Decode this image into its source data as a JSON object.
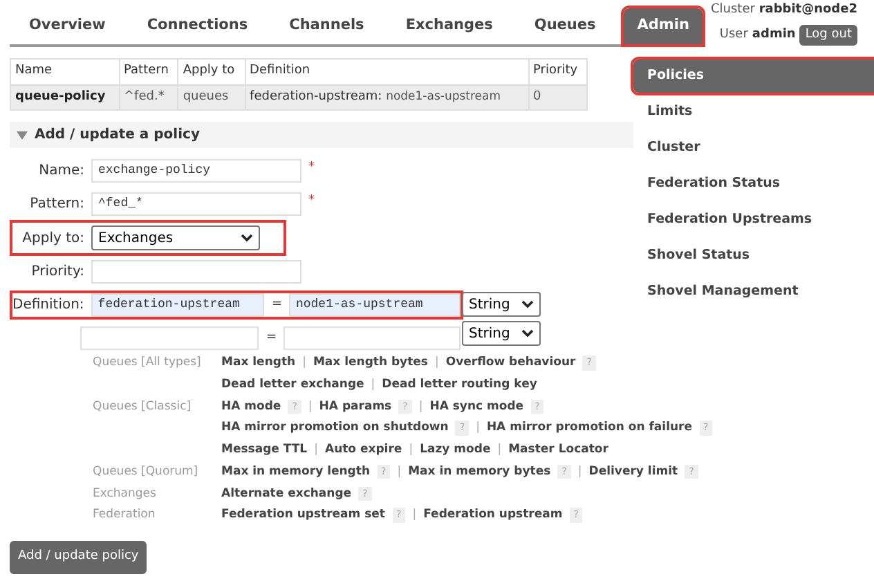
{
  "header": {
    "cluster_label": "Cluster",
    "cluster_name": "rabbit@node2",
    "user_label": "User",
    "user_name": "admin",
    "logout": "Log out"
  },
  "tabs": [
    {
      "label": "Overview",
      "selected": false,
      "highlighted": false
    },
    {
      "label": "Connections",
      "selected": false,
      "highlighted": false
    },
    {
      "label": "Channels",
      "selected": false,
      "highlighted": false
    },
    {
      "label": "Exchanges",
      "selected": false,
      "highlighted": false
    },
    {
      "label": "Queues",
      "selected": false,
      "highlighted": false
    },
    {
      "label": "Admin",
      "selected": true,
      "highlighted": true
    }
  ],
  "policies_table": {
    "columns": [
      "Name",
      "Pattern",
      "Apply to",
      "Definition",
      "Priority"
    ],
    "rows": [
      {
        "name": "queue-policy",
        "pattern": "^fed.*",
        "apply_to": "queues",
        "definition_key": "federation-upstream:",
        "definition_value": "node1-as-upstream",
        "priority": "0"
      }
    ]
  },
  "section": {
    "title": "Add / update a policy",
    "expanded": true
  },
  "form": {
    "name": {
      "label": "Name:",
      "value": "exchange-policy",
      "required": "*"
    },
    "pattern": {
      "label": "Pattern:",
      "value": "^fed_*",
      "required": "*"
    },
    "apply_to": {
      "label": "Apply to:",
      "value": "Exchanges",
      "highlighted": true
    },
    "priority": {
      "label": "Priority:"
    },
    "definition": {
      "label": "Definition:",
      "highlighted": true,
      "rows": [
        {
          "key": "federation-upstream",
          "equals": "=",
          "value": "node1-as-upstream",
          "type": "String"
        },
        {
          "key": "",
          "equals": "=",
          "value": "",
          "type": "String"
        }
      ]
    }
  },
  "help_groups": [
    {
      "label": "Queues [All types]",
      "lines": [
        [
          {
            "text": "Max length",
            "help": false
          },
          {
            "text": "Max length bytes",
            "help": false
          },
          {
            "text": "Overflow behaviour",
            "help": true
          }
        ],
        [
          {
            "text": "Dead letter exchange",
            "help": false
          },
          {
            "text": "Dead letter routing key",
            "help": false
          }
        ]
      ]
    },
    {
      "label": "Queues [Classic]",
      "lines": [
        [
          {
            "text": "HA mode",
            "help": true
          },
          {
            "text": "HA params",
            "help": true
          },
          {
            "text": "HA sync mode",
            "help": true
          }
        ],
        [
          {
            "text": "HA mirror promotion on shutdown",
            "help": true
          },
          {
            "text": "HA mirror promotion on failure",
            "help": true
          }
        ],
        [
          {
            "text": "Message TTL",
            "help": false
          },
          {
            "text": "Auto expire",
            "help": false
          },
          {
            "text": "Lazy mode",
            "help": false
          },
          {
            "text": "Master Locator",
            "help": false
          }
        ]
      ]
    },
    {
      "label": "Queues [Quorum]",
      "lines": [
        [
          {
            "text": "Max in memory length",
            "help": true
          },
          {
            "text": "Max in memory bytes",
            "help": true
          },
          {
            "text": "Delivery limit",
            "help": true
          }
        ]
      ]
    },
    {
      "label": "Exchanges",
      "lines": [
        [
          {
            "text": "Alternate exchange",
            "help": true
          }
        ]
      ]
    },
    {
      "label": "Federation",
      "lines": [
        [
          {
            "text": "Federation upstream set",
            "help": true
          },
          {
            "text": "Federation upstream",
            "help": true
          }
        ]
      ]
    }
  ],
  "help_mark": "?",
  "separator": "|",
  "submit": "Add / update policy",
  "sidebar": {
    "items": [
      {
        "label": "Policies",
        "selected": true,
        "highlighted": true
      },
      {
        "label": "Limits",
        "selected": false,
        "highlighted": false
      },
      {
        "label": "Cluster",
        "selected": false,
        "highlighted": false
      },
      {
        "label": "Federation Status",
        "selected": false,
        "highlighted": false
      },
      {
        "label": "Federation Upstreams",
        "selected": false,
        "highlighted": false
      },
      {
        "label": "Shovel Status",
        "selected": false,
        "highlighted": false
      },
      {
        "label": "Shovel Management",
        "selected": false,
        "highlighted": false
      }
    ]
  }
}
